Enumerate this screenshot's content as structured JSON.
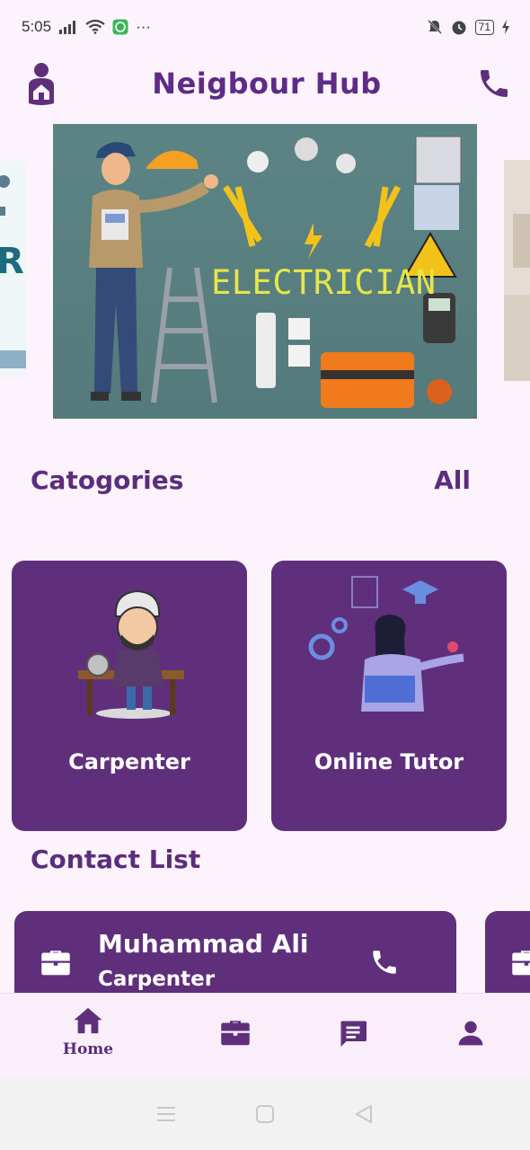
{
  "status": {
    "time": "5:05",
    "notification": "···",
    "battery": "71"
  },
  "header": {
    "title": "Neigbour Hub",
    "logo_icon": "house-person-logo",
    "call_icon": "phone-icon"
  },
  "carousel": {
    "main_banner_text": "ELECTRICIAN",
    "left_peek_text": "R"
  },
  "categories": {
    "title": "Catogories",
    "all_label": "All",
    "items": [
      {
        "label": "Carpenter",
        "icon": "carpenter-illustration"
      },
      {
        "label": "Online Tutor",
        "icon": "tutor-illustration"
      }
    ]
  },
  "contacts": {
    "title": "Contact List",
    "items": [
      {
        "name": "Muhammad Ali",
        "role": "Carpenter",
        "icon": "briefcase-icon"
      }
    ]
  },
  "bottom_nav": {
    "items": [
      {
        "label": "Home",
        "icon": "home-icon"
      },
      {
        "label": "",
        "icon": "briefcase-icon"
      },
      {
        "label": "",
        "icon": "chat-icon"
      },
      {
        "label": "",
        "icon": "person-icon"
      }
    ]
  },
  "colors": {
    "brand": "#5f2f7c",
    "background": "#fcf3fc",
    "banner_text": "#e8e54a"
  }
}
